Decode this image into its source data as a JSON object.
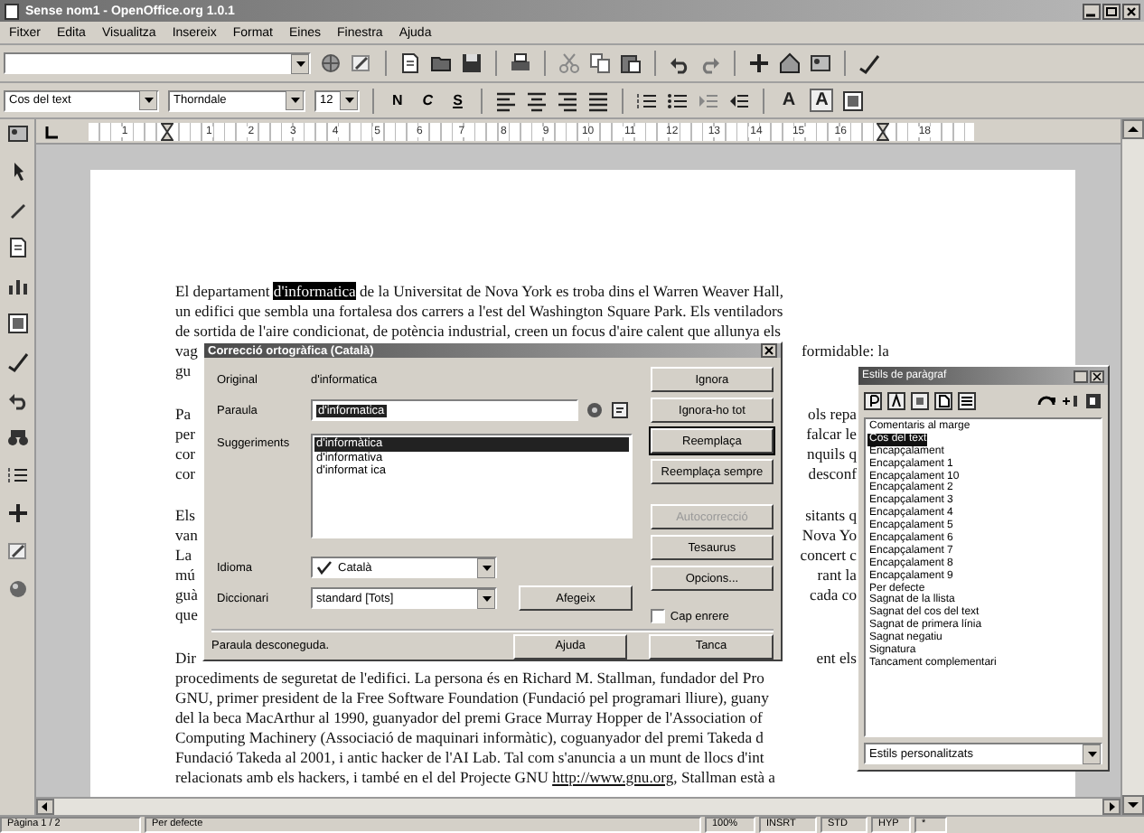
{
  "window": {
    "title": "Sense nom1 - OpenOffice.org 1.0.1"
  },
  "menu": [
    "Fitxer",
    "Edita",
    "Visualitza",
    "Insereix",
    "Format",
    "Eines",
    "Finestra",
    "Ajuda"
  ],
  "format_bar": {
    "style": "Cos del text",
    "font": "Thorndale",
    "size": "12",
    "text_buttons": [
      {
        "text": "N",
        "kind": "bold"
      },
      {
        "text": "C",
        "kind": "italic"
      },
      {
        "text": "S",
        "kind": "underline"
      }
    ],
    "font_buttons": [
      {
        "text": "A",
        "kind": "plain"
      },
      {
        "text": "A",
        "kind": "framed"
      }
    ]
  },
  "ruler": [
    {
      "kind": "number",
      "text": "1"
    },
    {
      "kind": "marker"
    },
    {
      "kind": "number",
      "text": "1"
    },
    {
      "kind": "number",
      "text": "2"
    },
    {
      "kind": "number",
      "text": "3"
    },
    {
      "kind": "number",
      "text": "4"
    },
    {
      "kind": "number",
      "text": "5"
    },
    {
      "kind": "number",
      "text": "6"
    },
    {
      "kind": "number",
      "text": "7"
    },
    {
      "kind": "number",
      "text": "8"
    },
    {
      "kind": "number",
      "text": "9"
    },
    {
      "kind": "number",
      "text": "10"
    },
    {
      "kind": "number",
      "text": "11"
    },
    {
      "kind": "number",
      "text": "12"
    },
    {
      "kind": "number",
      "text": "13"
    },
    {
      "kind": "number",
      "text": "14"
    },
    {
      "kind": "number",
      "text": "15"
    },
    {
      "kind": "number",
      "text": "16"
    },
    {
      "kind": "marker"
    },
    {
      "kind": "number",
      "text": "18"
    }
  ],
  "document": {
    "paragraphs": [
      {
        "lines": [
          {
            "parts": [
              {
                "text": "El departament ",
                "kind": "plain"
              },
              {
                "text": "d'informatica",
                "kind": "selection"
              },
              {
                "text": " de la Universitat de Nova York es troba dins el Warren Weaver Hall,",
                "kind": "plain"
              }
            ]
          },
          {
            "text": "un edifici que sembla una fortalesa dos carrers a l'est del Washington Square Park. Els ventiladors"
          },
          {
            "text": "de sortida de l'aire condicionat, de potència industrial, creen un focus d'aire calent que allunya els"
          },
          {
            "text": "vag",
            "right": "formidable: la"
          },
          {
            "text": "gu"
          }
        ]
      },
      {
        "lines": [
          {
            "text": "Pa",
            "right": "ols repa"
          },
          {
            "text": "per",
            "right": "falcar le"
          },
          {
            "text": "cor",
            "right": "nquils q"
          },
          {
            "text": "cor",
            "right": "desconf"
          }
        ]
      },
      {
        "lines": [
          {
            "text": "Els",
            "right": "sitants q"
          },
          {
            "text": "van",
            "right": "Nova Yo"
          },
          {
            "text": "La",
            "right": "concert c"
          },
          {
            "text": "mú",
            "right": "rant la"
          },
          {
            "text": "guà",
            "right": "cada co"
          },
          {
            "text": "que"
          }
        ]
      },
      {
        "lines": [
          {
            "text": "Dir",
            "right": "ent els"
          },
          {
            "text": "procediments de seguretat de l'edifici. La persona és en Richard M. Stallman, fundador del Pro"
          },
          {
            "text": "GNU, primer president de la Free Software Foundation (Fundació pel programari lliure), guany"
          },
          {
            "text": "del la beca MacArthur al 1990, guanyador del premi Grace Murray Hopper de l'Association of"
          },
          {
            "text": "Computing Machinery (Associació de maquinari informàtic), coguanyador del premi Takeda d"
          },
          {
            "text": "Fundació Takeda al 2001, i antic hacker de l'AI Lab. Tal com s'anuncia a un munt de llocs d'int"
          },
          {
            "parts": [
              {
                "text": "relacionats amb els hackers, i també en el del Projecte GNU ",
                "kind": "plain"
              },
              {
                "text": "http://www.gnu.org",
                "kind": "link"
              },
              {
                "text": ", Stallman està a",
                "kind": "plain"
              }
            ]
          }
        ]
      }
    ]
  },
  "spellcheck_dialog": {
    "title": "Correcció ortogràfica (Català)",
    "original_label": "Original",
    "original_value": "d'informatica",
    "word_label": "Paraula",
    "word_value": "d'informatica",
    "word_selected": true,
    "suggestions_label": "Suggeriments",
    "suggestions": [
      {
        "text": "d'informàtica",
        "selected": true
      },
      {
        "text": "d'informativa",
        "selected": false
      },
      {
        "text": "d'informat ica",
        "selected": false
      }
    ],
    "language_label": "Idioma",
    "language": "Català",
    "dictionary_label": "Diccionari",
    "dictionary": "standard [Tots]",
    "add_button": "Afegeix",
    "side_buttons": [
      {
        "label": "Ignora",
        "disabled": false,
        "default": false
      },
      {
        "label": "Ignora-ho tot",
        "disabled": false,
        "default": false
      },
      {
        "label": "Reemplaça",
        "disabled": false,
        "default": true
      },
      {
        "label": "Reemplaça sempre",
        "disabled": false,
        "default": false
      },
      {
        "label": "Autocorrecció",
        "disabled": true,
        "default": false
      },
      {
        "label": "Tesaurus",
        "disabled": false,
        "default": false
      },
      {
        "label": "Opcions...",
        "disabled": false,
        "default": false
      }
    ],
    "backwards": {
      "label": "Cap enrere",
      "checked": false
    },
    "status": "Paraula desconeguda.",
    "bottom_buttons": [
      "Ajuda",
      "Tanca"
    ]
  },
  "styles_panel": {
    "title": "Estils de paràgraf",
    "styles": [
      {
        "text": "Comentaris al marge",
        "selected": false
      },
      {
        "text": "Cos del text",
        "selected": true
      },
      {
        "text": "Encapçalament",
        "selected": false
      },
      {
        "text": "Encapçalament 1",
        "selected": false
      },
      {
        "text": "Encapçalament 10",
        "selected": false
      },
      {
        "text": "Encapçalament 2",
        "selected": false
      },
      {
        "text": "Encapçalament 3",
        "selected": false
      },
      {
        "text": "Encapçalament 4",
        "selected": false
      },
      {
        "text": "Encapçalament 5",
        "selected": false
      },
      {
        "text": "Encapçalament 6",
        "selected": false
      },
      {
        "text": "Encapçalament 7",
        "selected": false
      },
      {
        "text": "Encapçalament 8",
        "selected": false
      },
      {
        "text": "Encapçalament 9",
        "selected": false
      },
      {
        "text": "Per defecte",
        "selected": false
      },
      {
        "text": "Sagnat de la llista",
        "selected": false
      },
      {
        "text": "Sagnat del cos del text",
        "selected": false
      },
      {
        "text": "Sagnat de primera línia",
        "selected": false
      },
      {
        "text": "Sagnat negatiu",
        "selected": false
      },
      {
        "text": "Signatura",
        "selected": false
      },
      {
        "text": "Tancament complementari",
        "selected": false
      }
    ],
    "filter": "Estils personalitzats"
  },
  "status_bar": [
    "Pàgina 1 / 2",
    "Per defecte",
    "100%",
    "INSRT",
    "STD",
    "HYP",
    "*"
  ]
}
